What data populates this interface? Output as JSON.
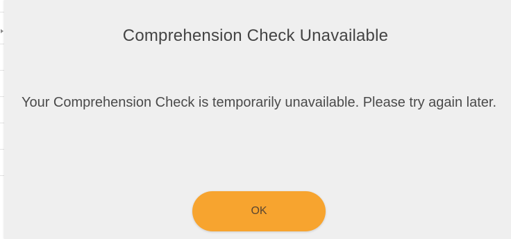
{
  "dialog": {
    "title": "Comprehension Check Unavailable",
    "message": "Your Comprehension Check is temporarily unavailable. Please try again later.",
    "ok_label": "OK"
  },
  "colors": {
    "dialog_background": "#efefef",
    "button_background": "#f7a42f",
    "text": "#444444"
  },
  "icons": {
    "background_arrow": "chevron-right-icon"
  }
}
